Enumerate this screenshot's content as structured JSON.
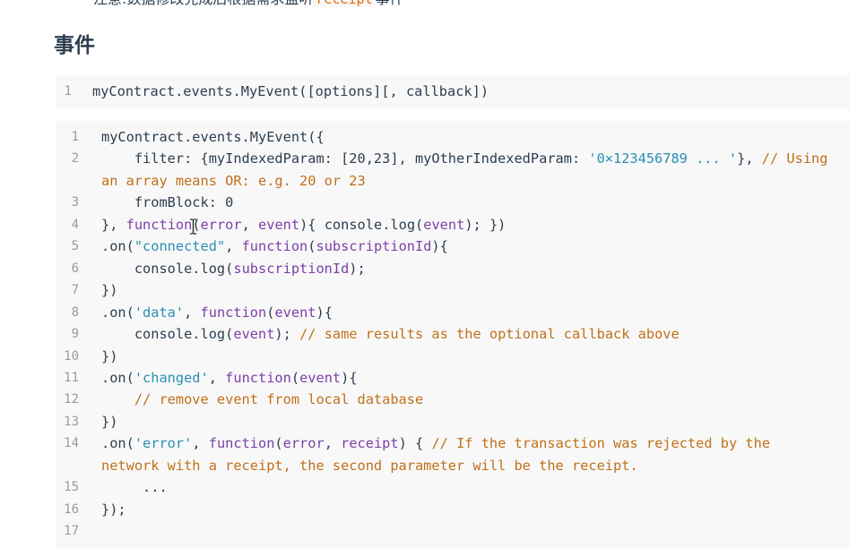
{
  "note": {
    "prefix": "注意:数据修改完成后根据需求监听",
    "code": "receipt",
    "suffix": "事件"
  },
  "heading": "事件",
  "signature": {
    "line_number": "1",
    "text": "myContract.events.MyEvent([options][, callback])"
  },
  "example": {
    "line_numbers": [
      "1",
      "2",
      "",
      "3",
      "4",
      "5",
      "6",
      "7",
      "8",
      "9",
      "10",
      "11",
      "12",
      "13",
      "14",
      "",
      "15",
      "16",
      "17"
    ],
    "tokens": {
      "l1": "myContract.events.MyEvent({",
      "l2a": "    filter: {myIndexedParam: [20,23], myOtherIndexedParam: ",
      "l2b": "'0×123456789 ... '",
      "l2c": "}, ",
      "l2d": "// Using",
      "l2e": "an array means OR: e.g. 20 or 23",
      "l3a": "    fromBlock: ",
      "l3b": "0",
      "l4a": "}, ",
      "l4b": "function",
      "l4c": "(",
      "l4d": "error",
      "l4e": ", ",
      "l4f": "event",
      "l4g": "){ console.log(",
      "l4h": "event",
      "l4i": "); })",
      "l5a": ".on(",
      "l5b": "\"connected\"",
      "l5c": ", ",
      "l5d": "function",
      "l5e": "(",
      "l5f": "subscriptionId",
      "l5g": "){",
      "l6a": "    console.log(",
      "l6b": "subscriptionId",
      "l6c": ");",
      "l7": "})",
      "l8a": ".on(",
      "l8b": "'data'",
      "l8c": ", ",
      "l8d": "function",
      "l8e": "(",
      "l8f": "event",
      "l8g": "){",
      "l9a": "    console.log(",
      "l9b": "event",
      "l9c": "); ",
      "l9d": "// same results as the optional callback above",
      "l10": "})",
      "l11a": ".on(",
      "l11b": "'changed'",
      "l11c": ", ",
      "l11d": "function",
      "l11e": "(",
      "l11f": "event",
      "l11g": "){",
      "l12": "    // remove event from local database",
      "l13": "})",
      "l14a": ".on(",
      "l14b": "'error'",
      "l14c": ", ",
      "l14d": "function",
      "l14e": "(",
      "l14f": "error",
      "l14g": ", ",
      "l14h": "receipt",
      "l14i": ") { ",
      "l14j": "// If the transaction was rejected by the",
      "l14k": "network with a receipt, the second parameter will be the receipt.",
      "l15": "     ...",
      "l16": "});",
      "l17": ""
    }
  },
  "colors": {
    "background": "#ffffff",
    "code_background": "#f8f8f8",
    "keyword": "#7c3fa8",
    "string": "#2a8fb4",
    "comment": "#c0701a",
    "text": "#2c3e50",
    "line_number": "#999999"
  }
}
